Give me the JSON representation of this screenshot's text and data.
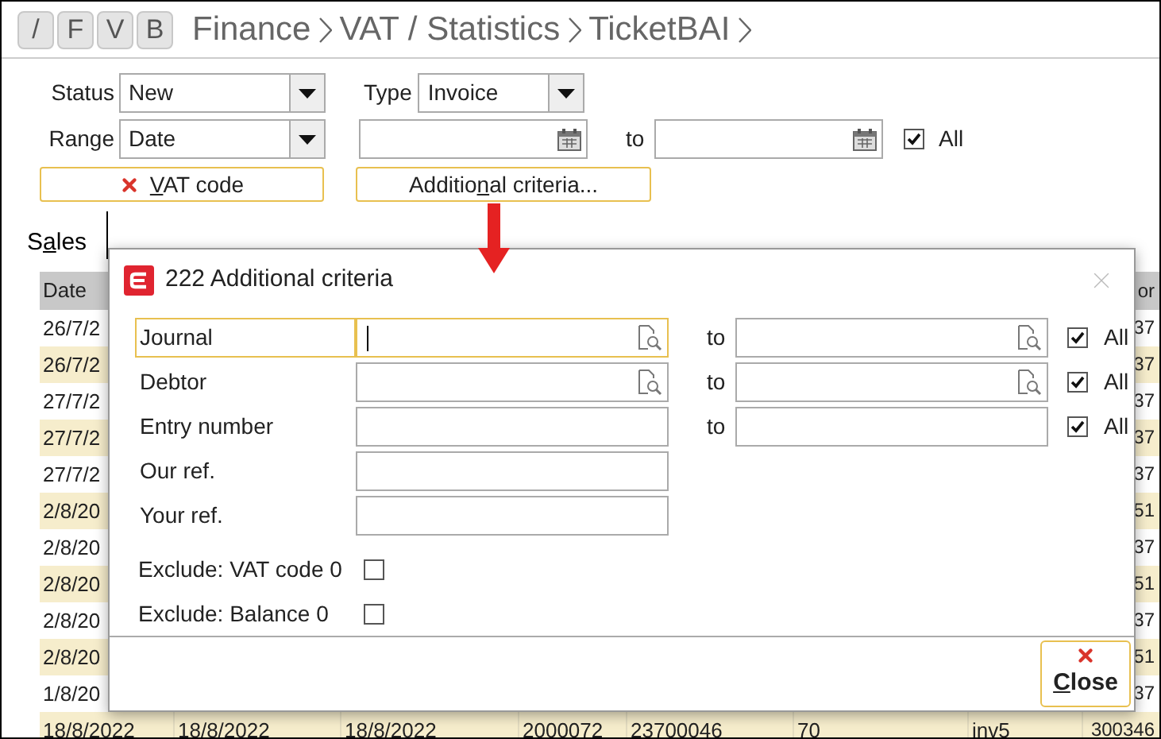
{
  "toolbar": {
    "buttons": [
      "/",
      "F",
      "V",
      "B"
    ]
  },
  "breadcrumb": [
    "Finance",
    "VAT / Statistics",
    "TicketBAI"
  ],
  "filters": {
    "status": {
      "label": "Status",
      "value": "New"
    },
    "type": {
      "label": "Type",
      "value": "Invoice"
    },
    "range": {
      "label": "Range",
      "value": "Date"
    },
    "to_label": "to",
    "all": {
      "label": "All",
      "checked": true
    }
  },
  "buttons": [
    {
      "label_parts": [
        {
          "text": "V",
          "underlined": true
        },
        {
          "text": "AT code",
          "underlined": false
        }
      ],
      "kind": "remove"
    },
    {
      "label_parts": [
        {
          "text": "Additio",
          "underlined": false
        },
        {
          "text": "n",
          "underlined": true
        },
        {
          "text": "al criteria...",
          "underlined": false
        }
      ],
      "kind": "plain"
    }
  ],
  "tabs": [
    {
      "label_parts": [
        {
          "text": "S",
          "underlined": false
        },
        {
          "text": "a",
          "underlined": true
        },
        {
          "text": "les",
          "underlined": false
        }
      ],
      "selected": true
    }
  ],
  "table": {
    "columns": [
      "Date",
      null,
      null,
      null,
      null,
      null,
      null,
      "or"
    ],
    "rows": [
      [
        "26/7/2",
        null,
        null,
        null,
        null,
        null,
        null,
        "37"
      ],
      [
        "26/7/2",
        null,
        null,
        null,
        null,
        null,
        null,
        "37"
      ],
      [
        "27/7/2",
        null,
        null,
        null,
        null,
        null,
        null,
        "37"
      ],
      [
        "27/7/2",
        null,
        null,
        null,
        null,
        null,
        null,
        "37"
      ],
      [
        "27/7/2",
        null,
        null,
        null,
        null,
        null,
        null,
        "37"
      ],
      [
        "2/8/20",
        null,
        null,
        null,
        null,
        null,
        null,
        "51"
      ],
      [
        "2/8/20",
        null,
        null,
        null,
        null,
        null,
        null,
        "37"
      ],
      [
        "2/8/20",
        null,
        null,
        null,
        null,
        null,
        null,
        "51"
      ],
      [
        "2/8/20",
        null,
        null,
        null,
        null,
        null,
        null,
        "37"
      ],
      [
        "2/8/20",
        null,
        null,
        null,
        null,
        null,
        null,
        "51"
      ],
      [
        "1/8/20",
        null,
        null,
        null,
        null,
        null,
        null,
        "37"
      ],
      [
        "18/8/2022",
        "18/8/2022",
        "18/8/2022",
        "2000072",
        "23700046",
        "70",
        "inv5",
        "300346"
      ]
    ]
  },
  "dialog": {
    "title": "222 Additional criteria",
    "fields": [
      {
        "label": "Journal",
        "kind": "lookup_range",
        "focused": true,
        "to_label": "to",
        "all": {
          "label": "All",
          "checked": true
        }
      },
      {
        "label": "Debtor",
        "kind": "lookup_range",
        "focused": false,
        "to_label": "to",
        "all": {
          "label": "All",
          "checked": true
        }
      },
      {
        "label": "Entry number",
        "kind": "range",
        "focused": false,
        "to_label": "to",
        "all": {
          "label": "All",
          "checked": true
        }
      },
      {
        "label": "Our ref.",
        "kind": "text",
        "focused": false
      },
      {
        "label": "Your ref.",
        "kind": "text",
        "focused": false
      }
    ],
    "checkboxes": [
      {
        "label": "Exclude: VAT code 0",
        "checked": false
      },
      {
        "label": "Exclude: Balance 0",
        "checked": false
      }
    ],
    "close_button": {
      "label_parts": [
        {
          "text": "C",
          "underlined": true
        },
        {
          "text": "lose",
          "underlined": false
        }
      ]
    }
  }
}
